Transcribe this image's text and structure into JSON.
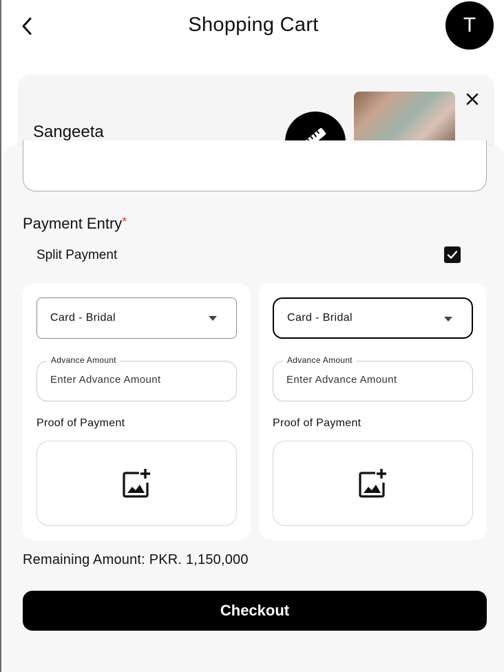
{
  "header": {
    "title": "Shopping Cart",
    "avatar_initial": "T"
  },
  "cart_item": {
    "name": "Sangeeta"
  },
  "payment": {
    "section_title": "Payment Entry",
    "required_mark": "*",
    "split_label": "Split Payment",
    "split_checked": true,
    "entries": [
      {
        "method": "Card - Bridal",
        "advance_label": "Advance Amount",
        "advance_placeholder": "Enter Advance Amount",
        "proof_label": "Proof of Payment"
      },
      {
        "method": "Card - Bridal",
        "advance_label": "Advance Amount",
        "advance_placeholder": "Enter Advance Amount",
        "proof_label": "Proof of Payment"
      }
    ],
    "remaining_text": "Remaining Amount: PKR. 1,150,000"
  },
  "checkout": {
    "label": "Checkout"
  },
  "icons": {
    "back": "chevron-left-icon",
    "measure": "ruler-icon",
    "remove": "close-icon",
    "check": "checkmark-icon",
    "add_image": "add-photo-icon",
    "dropdown": "caret-down-icon"
  }
}
